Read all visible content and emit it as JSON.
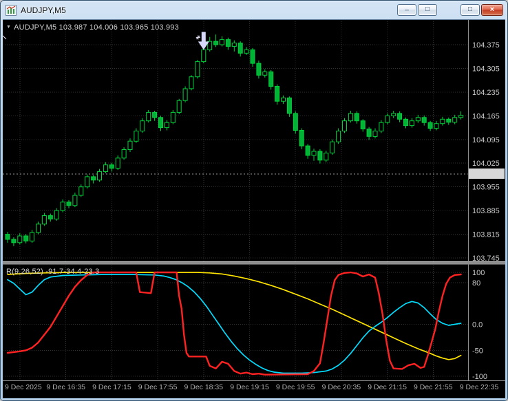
{
  "window": {
    "title": "AUDJPY,M5",
    "icons": {
      "minimize": "_",
      "restore": "□",
      "maximize": "□",
      "close": "×",
      "symbol_dropdown": "▼"
    }
  },
  "chart": {
    "symbol_ohlc_label": "AUDJPY,M5  103.987 104.006 103.965 103.993",
    "indicator_label": "R(9,26,52) -91.7-34.4-23.3"
  },
  "chart_data": {
    "type": "candlestick",
    "symbol": "AUDJPY",
    "timeframe": "M5",
    "last_ohlc": {
      "open": "103.987",
      "high": "104.006",
      "low": "103.965",
      "close": "103.993"
    },
    "current_price": "103.993",
    "price_ticks": [
      "104.375",
      "104.305",
      "104.235",
      "104.165",
      "104.095",
      "104.025",
      "103.955",
      "103.885",
      "103.815",
      "103.745"
    ],
    "time_labels": [
      "9 Dec 2025",
      "9 Dec 16:35",
      "9 Dec 17:15",
      "9 Dec 17:55",
      "9 Dec 18:35",
      "9 Dec 19:15",
      "9 Dec 19:55",
      "9 Dec 20:35",
      "9 Dec 21:15",
      "9 Dec 21:55",
      "9 Dec 22:35"
    ],
    "grid_on": true,
    "colors": {
      "background": "#000000",
      "grid": "#323232",
      "candle": "#00D23C",
      "candle_fill": "#00B336",
      "price_box_bg": "#d8d8d8",
      "arrow": "#d8d8fa",
      "red_line": "#ff2222",
      "cyan_line": "#00ddff",
      "yellow_line": "#ffe400"
    },
    "arrow": {
      "index": 32,
      "price": 104.36,
      "color": "#d8d8fa"
    },
    "candles": [
      [
        103.815,
        103.822,
        103.79,
        103.8
      ],
      [
        103.8,
        103.806,
        103.78,
        103.79
      ],
      [
        103.79,
        103.818,
        103.785,
        103.81
      ],
      [
        103.81,
        103.816,
        103.788,
        103.795
      ],
      [
        103.795,
        103.828,
        103.79,
        103.82
      ],
      [
        103.82,
        103.852,
        103.815,
        103.845
      ],
      [
        103.845,
        103.878,
        103.84,
        103.87
      ],
      [
        103.87,
        103.876,
        103.852,
        103.86
      ],
      [
        103.86,
        103.892,
        103.855,
        103.885
      ],
      [
        103.885,
        103.918,
        103.88,
        103.91
      ],
      [
        103.91,
        103.916,
        103.892,
        103.9
      ],
      [
        103.9,
        103.938,
        103.895,
        103.93
      ],
      [
        103.93,
        103.962,
        103.925,
        103.955
      ],
      [
        103.955,
        103.992,
        103.95,
        103.985
      ],
      [
        103.985,
        103.99,
        103.965,
        103.975
      ],
      [
        103.975,
        104.008,
        103.97,
        104.0
      ],
      [
        104.0,
        104.028,
        103.995,
        104.02
      ],
      [
        104.02,
        104.026,
        104.0,
        104.01
      ],
      [
        104.01,
        104.048,
        104.005,
        104.04
      ],
      [
        104.04,
        104.072,
        104.035,
        104.065
      ],
      [
        104.065,
        104.098,
        104.058,
        104.09
      ],
      [
        104.09,
        104.128,
        104.085,
        104.12
      ],
      [
        104.12,
        104.158,
        104.115,
        104.15
      ],
      [
        104.15,
        104.182,
        104.145,
        104.175
      ],
      [
        104.175,
        104.18,
        104.15,
        104.16
      ],
      [
        104.16,
        104.165,
        104.12,
        104.13
      ],
      [
        104.13,
        104.152,
        104.122,
        104.145
      ],
      [
        104.145,
        104.182,
        104.14,
        104.175
      ],
      [
        104.175,
        104.215,
        104.17,
        104.21
      ],
      [
        104.21,
        104.252,
        104.205,
        104.245
      ],
      [
        104.245,
        104.285,
        104.24,
        104.28
      ],
      [
        104.28,
        104.33,
        104.275,
        104.325
      ],
      [
        104.325,
        104.368,
        104.32,
        104.36
      ],
      [
        104.36,
        104.398,
        104.355,
        104.385
      ],
      [
        104.385,
        104.405,
        104.368,
        104.375
      ],
      [
        104.375,
        104.4,
        104.37,
        104.39
      ],
      [
        104.39,
        104.396,
        104.36,
        104.37
      ],
      [
        104.37,
        104.388,
        104.355,
        104.38
      ],
      [
        104.38,
        104.385,
        104.34,
        104.35
      ],
      [
        104.35,
        104.368,
        104.345,
        104.36
      ],
      [
        104.36,
        104.365,
        104.31,
        104.32
      ],
      [
        104.32,
        104.328,
        104.275,
        104.285
      ],
      [
        104.285,
        104.302,
        104.278,
        104.295
      ],
      [
        104.295,
        104.3,
        104.242,
        104.252
      ],
      [
        104.252,
        104.258,
        104.198,
        104.208
      ],
      [
        104.208,
        104.225,
        104.2,
        104.218
      ],
      [
        104.218,
        104.222,
        104.162,
        104.172
      ],
      [
        104.172,
        104.178,
        104.112,
        104.122
      ],
      [
        104.122,
        104.128,
        104.066,
        104.076
      ],
      [
        104.076,
        104.082,
        104.038,
        104.048
      ],
      [
        104.048,
        104.068,
        104.032,
        104.06
      ],
      [
        104.06,
        104.066,
        104.024,
        104.034
      ],
      [
        104.034,
        104.062,
        104.028,
        104.055
      ],
      [
        104.055,
        104.095,
        104.05,
        104.088
      ],
      [
        104.088,
        104.128,
        104.082,
        104.12
      ],
      [
        104.12,
        104.158,
        104.114,
        104.15
      ],
      [
        104.15,
        104.18,
        104.145,
        104.172
      ],
      [
        104.172,
        104.178,
        104.142,
        104.15
      ],
      [
        104.15,
        104.155,
        104.118,
        104.126
      ],
      [
        104.126,
        104.132,
        104.094,
        104.104
      ],
      [
        104.104,
        104.128,
        104.098,
        104.12
      ],
      [
        104.12,
        104.152,
        104.114,
        104.145
      ],
      [
        104.145,
        104.172,
        104.14,
        104.165
      ],
      [
        104.165,
        104.18,
        104.158,
        104.172
      ],
      [
        104.172,
        104.178,
        104.146,
        104.155
      ],
      [
        104.155,
        104.16,
        104.128,
        104.136
      ],
      [
        104.136,
        104.158,
        104.13,
        104.15
      ],
      [
        104.15,
        104.168,
        104.144,
        104.16
      ],
      [
        104.16,
        104.166,
        104.136,
        104.145
      ],
      [
        104.145,
        104.15,
        104.12,
        104.128
      ],
      [
        104.128,
        104.15,
        104.122,
        104.142
      ],
      [
        104.142,
        104.162,
        104.136,
        104.155
      ],
      [
        104.155,
        104.16,
        104.138,
        104.146
      ],
      [
        104.146,
        104.168,
        104.14,
        104.16
      ],
      [
        104.16,
        104.178,
        104.154,
        104.166
      ]
    ],
    "indicator": {
      "label": "R(9,26,52) -91.7-34.4-23.3",
      "name": "R",
      "params": [
        9,
        26,
        52
      ],
      "values": [
        "-91.7",
        "-34.4",
        "-23.3"
      ],
      "range": [
        100,
        -100
      ],
      "ticks": [
        {
          "label": "100",
          "value": 100
        },
        {
          "label": "80",
          "value": 80
        },
        {
          "label": "0.0",
          "value": 0
        },
        {
          "label": "-50",
          "value": -50
        },
        {
          "label": "-100",
          "value": -100
        }
      ],
      "series": [
        {
          "name": "fast-red",
          "color": "#ff2222",
          "width": 2.4,
          "points": [
            [
              0,
              -55
            ],
            [
              2,
              -52
            ],
            [
              3,
              -50
            ],
            [
              4,
              -45
            ],
            [
              5,
              -35
            ],
            [
              6,
              -20
            ],
            [
              7,
              -5
            ],
            [
              8,
              15
            ],
            [
              9,
              35
            ],
            [
              10,
              55
            ],
            [
              11,
              72
            ],
            [
              12,
              85
            ],
            [
              13,
              95
            ],
            [
              14,
              100
            ],
            [
              20,
              100
            ],
            [
              21,
              100
            ],
            [
              21.6,
              62
            ],
            [
              23.4,
              60
            ],
            [
              24,
              100
            ],
            [
              27.6,
              100
            ],
            [
              28,
              55
            ],
            [
              28.4,
              30
            ],
            [
              28.8,
              -20
            ],
            [
              29.2,
              -55
            ],
            [
              29.6,
              -62
            ],
            [
              32.4,
              -62
            ],
            [
              33,
              -80
            ],
            [
              34,
              -85
            ],
            [
              35,
              -72
            ],
            [
              36,
              -76
            ],
            [
              37,
              -90
            ],
            [
              38,
              -95
            ],
            [
              39,
              -93
            ],
            [
              40,
              -96
            ],
            [
              41,
              -95
            ],
            [
              42,
              -97
            ],
            [
              49,
              -96
            ],
            [
              50,
              -90
            ],
            [
              51,
              -75
            ],
            [
              51.6,
              -35
            ],
            [
              52.2,
              10
            ],
            [
              52.8,
              55
            ],
            [
              53.4,
              85
            ],
            [
              54,
              95
            ],
            [
              55,
              99
            ],
            [
              56,
              100
            ],
            [
              57,
              98
            ],
            [
              58,
              92
            ],
            [
              59,
              96
            ],
            [
              60,
              90
            ],
            [
              60.6,
              60
            ],
            [
              61.2,
              20
            ],
            [
              61.8,
              -30
            ],
            [
              62.4,
              -70
            ],
            [
              63,
              -85
            ],
            [
              64.4,
              -86
            ],
            [
              65.4,
              -79
            ],
            [
              66.4,
              -76
            ],
            [
              67.4,
              -84
            ],
            [
              68,
              -82
            ],
            [
              68.6,
              -60
            ],
            [
              69.2,
              -35
            ],
            [
              69.8,
              -10
            ],
            [
              70.4,
              25
            ],
            [
              71,
              55
            ],
            [
              71.6,
              78
            ],
            [
              72.2,
              90
            ],
            [
              73,
              95
            ],
            [
              74,
              96
            ]
          ]
        },
        {
          "name": "mid-cyan",
          "color": "#00ddff",
          "width": 1.7,
          "points": [
            [
              0,
              86
            ],
            [
              1,
              79
            ],
            [
              2,
              68
            ],
            [
              3,
              57
            ],
            [
              4,
              62
            ],
            [
              5,
              75
            ],
            [
              6,
              86
            ],
            [
              7,
              91
            ],
            [
              9,
              94
            ],
            [
              12,
              95
            ],
            [
              16,
              96
            ],
            [
              20,
              96
            ],
            [
              24,
              95
            ],
            [
              25.5,
              93
            ],
            [
              26.5,
              90
            ],
            [
              27.5,
              86
            ],
            [
              28.5,
              80
            ],
            [
              29.5,
              72
            ],
            [
              30.5,
              62
            ],
            [
              31.5,
              49
            ],
            [
              32.5,
              34
            ],
            [
              33.5,
              17
            ],
            [
              34.5,
              0
            ],
            [
              35.5,
              -17
            ],
            [
              36.5,
              -33
            ],
            [
              37.5,
              -47
            ],
            [
              38.5,
              -59
            ],
            [
              39.5,
              -69
            ],
            [
              40.5,
              -77
            ],
            [
              41.5,
              -84
            ],
            [
              42.5,
              -89
            ],
            [
              43.5,
              -92
            ],
            [
              45,
              -94
            ],
            [
              48,
              -94
            ],
            [
              50,
              -93
            ],
            [
              52,
              -90
            ],
            [
              53,
              -86
            ],
            [
              54,
              -79
            ],
            [
              55,
              -69
            ],
            [
              56,
              -56
            ],
            [
              57,
              -41
            ],
            [
              58,
              -26
            ],
            [
              59,
              -13
            ],
            [
              60,
              -4
            ],
            [
              61,
              4
            ],
            [
              62,
              13
            ],
            [
              63,
              23
            ],
            [
              64,
              32
            ],
            [
              65,
              40
            ],
            [
              66,
              44
            ],
            [
              67,
              41
            ],
            [
              68,
              32
            ],
            [
              69,
              20
            ],
            [
              70,
              9
            ],
            [
              71,
              2
            ],
            [
              72,
              -2
            ],
            [
              73,
              0
            ],
            [
              74,
              2
            ]
          ]
        },
        {
          "name": "slow-yellow",
          "color": "#ffe400",
          "width": 1.7,
          "points": [
            [
              0,
              96
            ],
            [
              3,
              98
            ],
            [
              6,
              99
            ],
            [
              10,
              100
            ],
            [
              31,
              100
            ],
            [
              33,
              99
            ],
            [
              35,
              97
            ],
            [
              37,
              93
            ],
            [
              39,
              88
            ],
            [
              41,
              82
            ],
            [
              43,
              75
            ],
            [
              45,
              67
            ],
            [
              47,
              58
            ],
            [
              49,
              49
            ],
            [
              51,
              39
            ],
            [
              53,
              29
            ],
            [
              55,
              18
            ],
            [
              57,
              7
            ],
            [
              59,
              -4
            ],
            [
              61,
              -15
            ],
            [
              63,
              -26
            ],
            [
              65,
              -37
            ],
            [
              67,
              -47
            ],
            [
              69,
              -56
            ],
            [
              70,
              -61
            ],
            [
              71,
              -65
            ],
            [
              72,
              -68
            ],
            [
              73,
              -66
            ],
            [
              74,
              -60
            ]
          ]
        }
      ]
    }
  }
}
